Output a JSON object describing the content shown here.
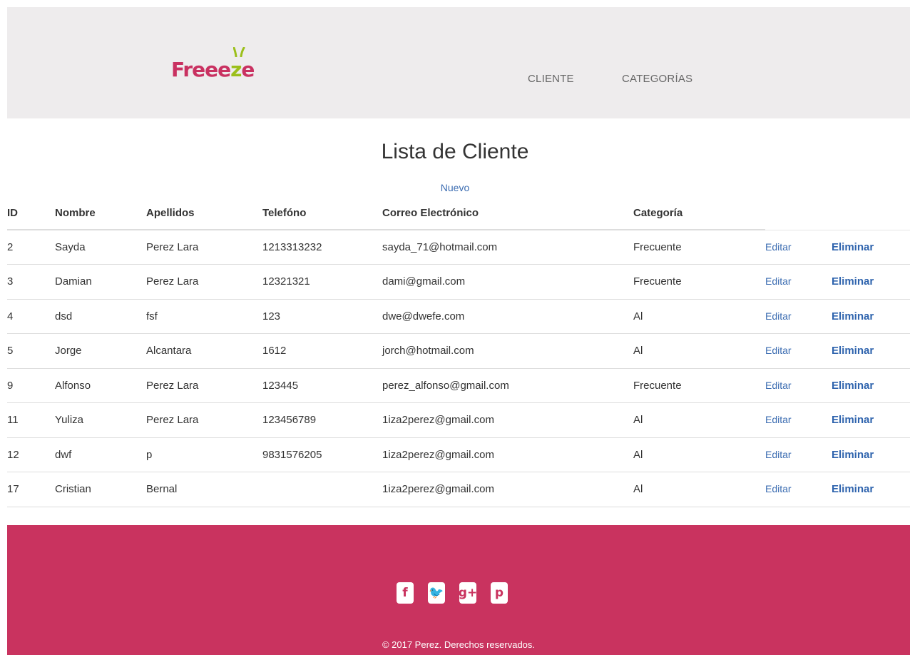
{
  "brand": {
    "name_prefix": "Freee",
    "name_z": "z",
    "name_suffix": "e",
    "color": "#c93161",
    "accent": "#9bbf1a"
  },
  "nav": {
    "cliente": "CLIENTE",
    "categorias": "CATEGORÍAS"
  },
  "page": {
    "title": "Lista de Cliente",
    "new_link": "Nuevo"
  },
  "table": {
    "headers": {
      "id": "ID",
      "nombre": "Nombre",
      "apellidos": "Apellidos",
      "telefono": "Telefóno",
      "correo": "Correo Electrónico",
      "categoria": "Categoría"
    },
    "edit_label": "Editar",
    "delete_label": "Eliminar",
    "rows": [
      {
        "id": "2",
        "nombre": "Sayda",
        "apellidos": "Perez Lara",
        "telefono": "1213313232",
        "correo": "sayda_71@hotmail.com",
        "categoria": "Frecuente"
      },
      {
        "id": "3",
        "nombre": "Damian",
        "apellidos": "Perez Lara",
        "telefono": "12321321",
        "correo": "dami@gmail.com",
        "categoria": "Frecuente"
      },
      {
        "id": "4",
        "nombre": "dsd",
        "apellidos": "fsf",
        "telefono": "123",
        "correo": "dwe@dwefe.com",
        "categoria": "Al"
      },
      {
        "id": "5",
        "nombre": "Jorge",
        "apellidos": "Alcantara",
        "telefono": "1612",
        "correo": "jorch@hotmail.com",
        "categoria": "Al"
      },
      {
        "id": "9",
        "nombre": "Alfonso",
        "apellidos": "Perez Lara",
        "telefono": "123445",
        "correo": "perez_alfonso@gmail.com",
        "categoria": "Frecuente"
      },
      {
        "id": "11",
        "nombre": "Yuliza",
        "apellidos": "Perez Lara",
        "telefono": "123456789",
        "correo": "1iza2perez@gmail.com",
        "categoria": "Al"
      },
      {
        "id": "12",
        "nombre": "dwf",
        "apellidos": "p",
        "telefono": "9831576205",
        "correo": "1iza2perez@gmail.com",
        "categoria": "Al"
      },
      {
        "id": "17",
        "nombre": "Cristian",
        "apellidos": "Bernal",
        "telefono": "",
        "correo": "1iza2perez@gmail.com",
        "categoria": "Al"
      }
    ]
  },
  "footer": {
    "social": [
      {
        "icon": "facebook-icon",
        "glyph": "f"
      },
      {
        "icon": "twitter-icon",
        "glyph": "🐦"
      },
      {
        "icon": "google-plus-icon",
        "glyph": "g+"
      },
      {
        "icon": "pinterest-icon",
        "glyph": "p"
      }
    ],
    "copyright": "© 2017 Perez. Derechos reservados.",
    "background": "#c9335f"
  }
}
